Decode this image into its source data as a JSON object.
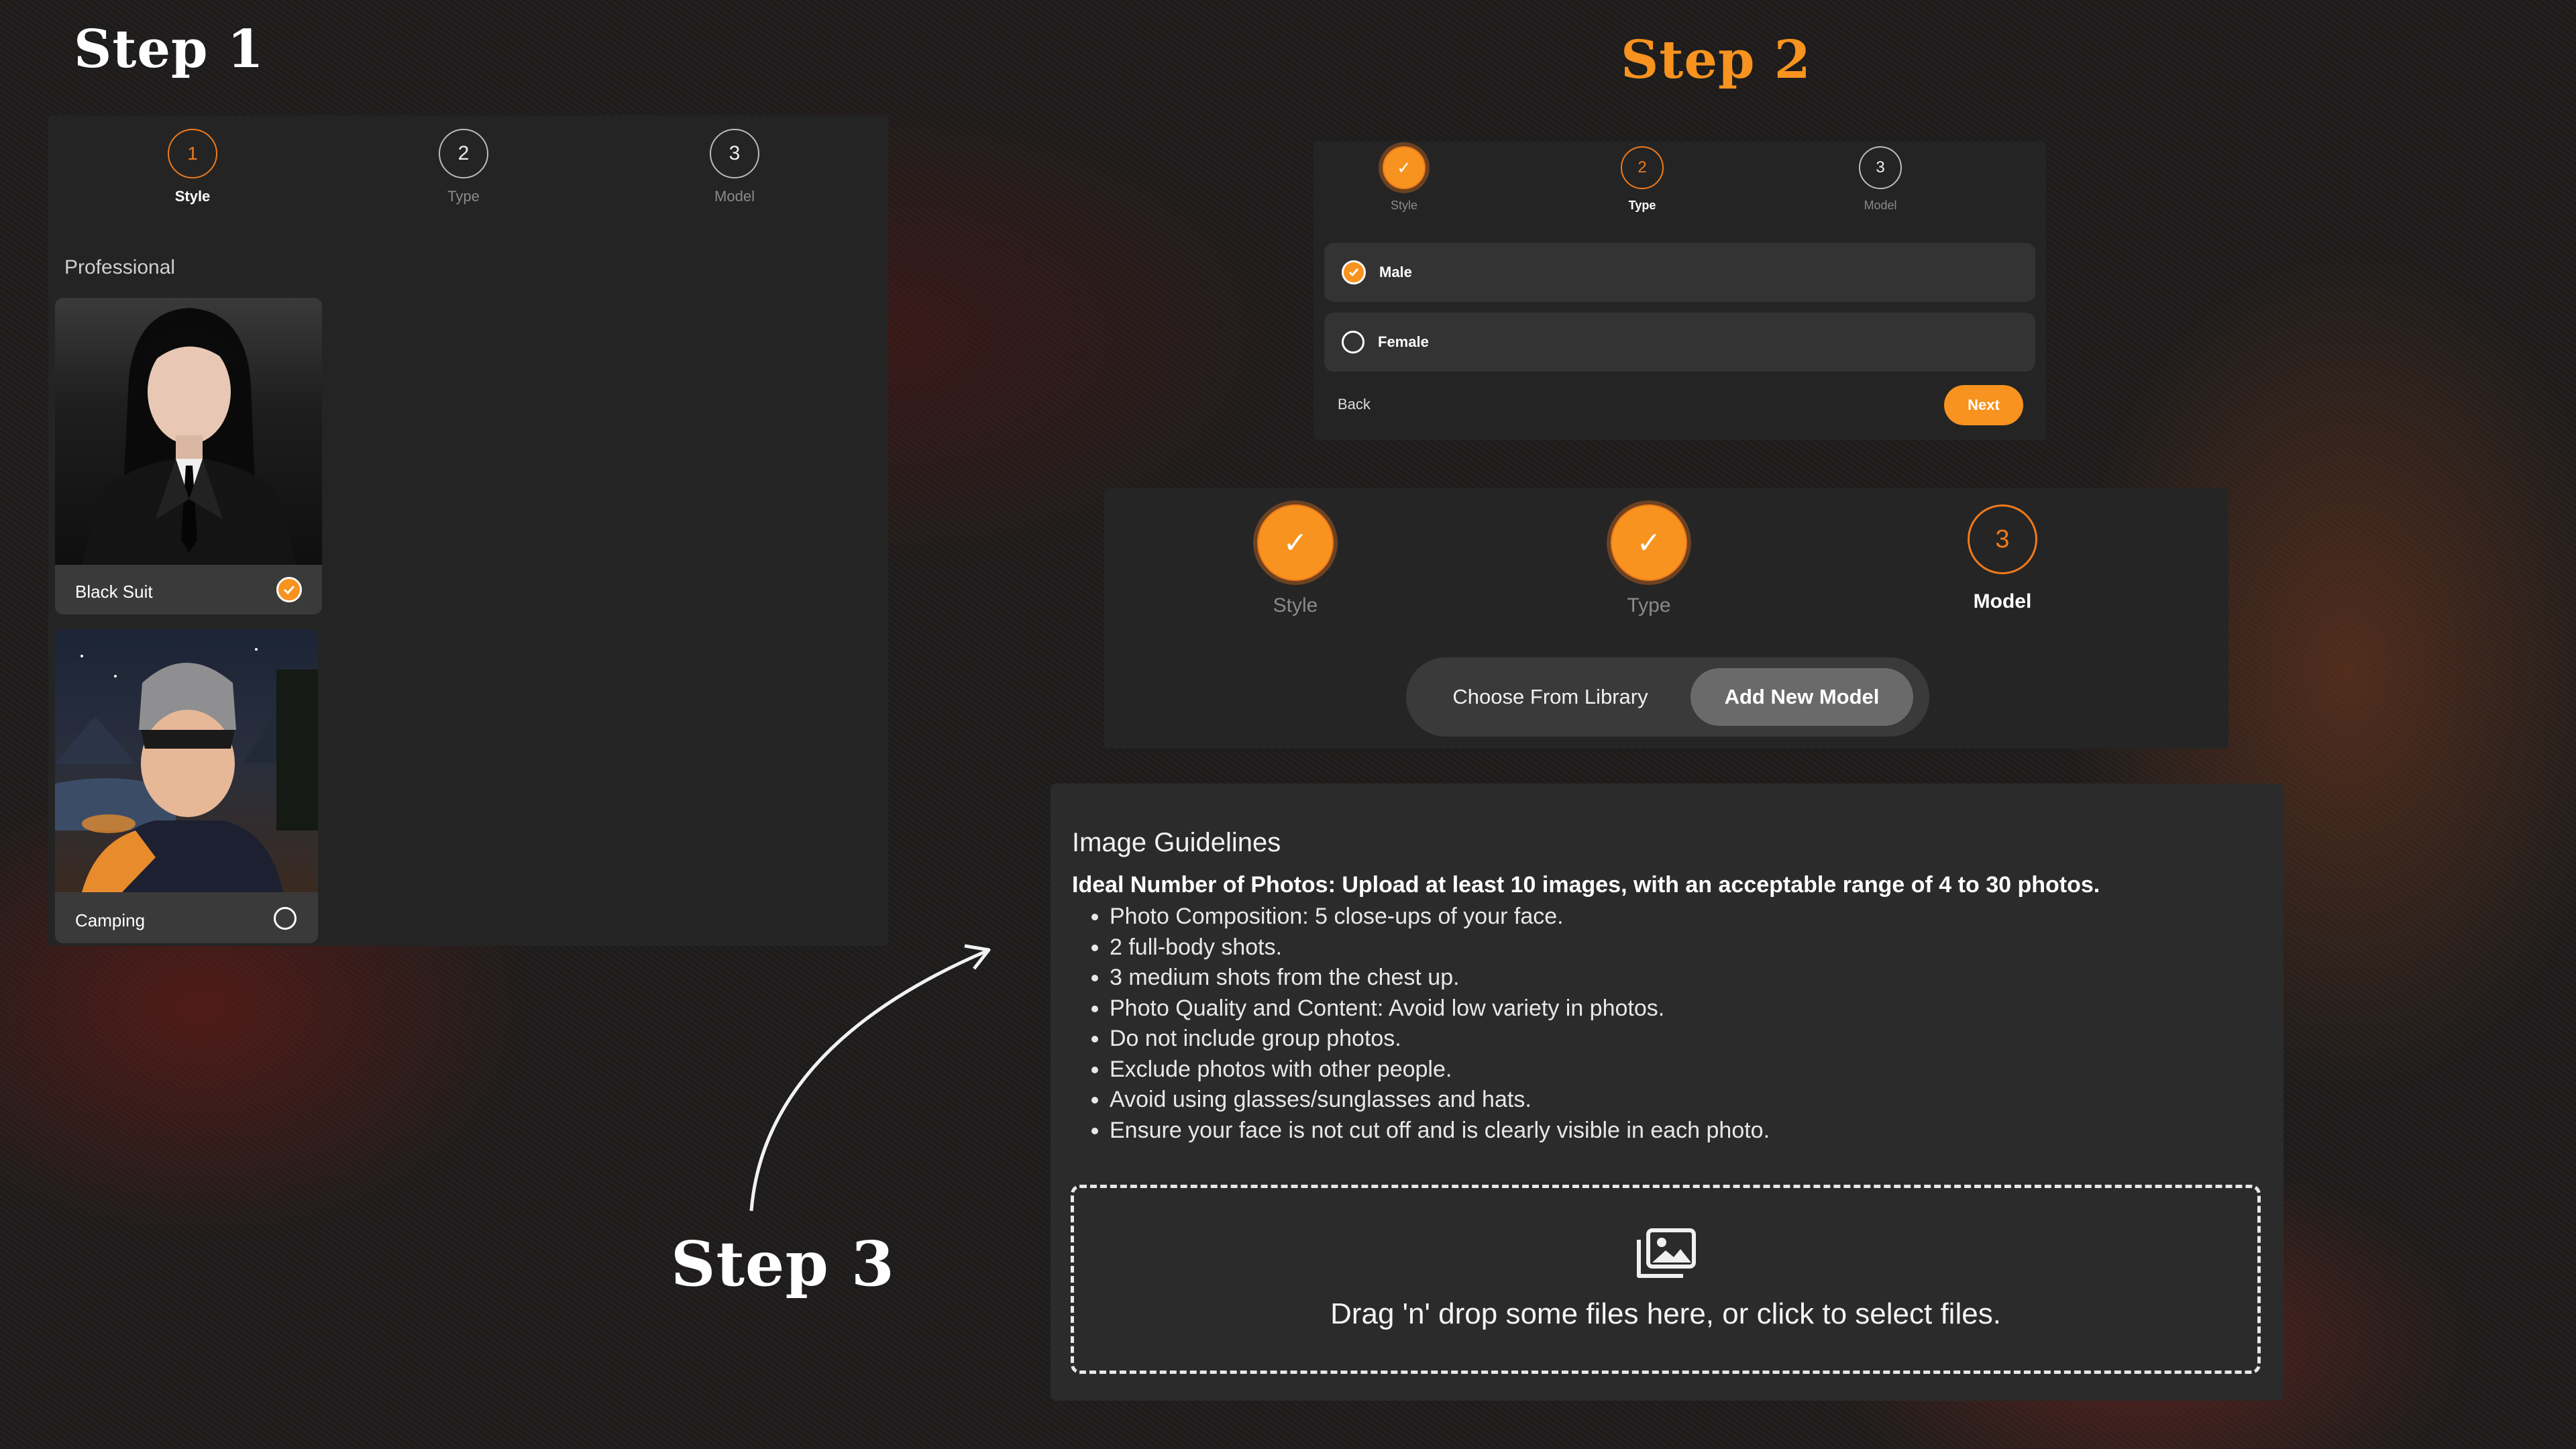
{
  "step1": {
    "title": "Step 1",
    "stepper": [
      {
        "num": "1",
        "label": "Style",
        "state": "active"
      },
      {
        "num": "2",
        "label": "Type",
        "state": "pending"
      },
      {
        "num": "3",
        "label": "Model",
        "state": "pending"
      }
    ],
    "section_label": "Professional",
    "cards": [
      {
        "label": "Black Suit",
        "selected": true
      },
      {
        "label": "Camping",
        "selected": false
      }
    ]
  },
  "step2": {
    "title": "Step 2",
    "stepper": [
      {
        "num": "✓",
        "label": "Style",
        "state": "done"
      },
      {
        "num": "2",
        "label": "Type",
        "state": "active"
      },
      {
        "num": "3",
        "label": "Model",
        "state": "pending"
      }
    ],
    "options": [
      {
        "label": "Male",
        "selected": true
      },
      {
        "label": "Female",
        "selected": false
      }
    ],
    "back_label": "Back",
    "next_label": "Next"
  },
  "step3": {
    "title": "Step 3",
    "stepper": [
      {
        "num": "✓",
        "label": "Style",
        "state": "done"
      },
      {
        "num": "✓",
        "label": "Type",
        "state": "done"
      },
      {
        "num": "3",
        "label": "Model",
        "state": "active"
      }
    ],
    "toggle": {
      "option_a": "Choose From Library",
      "option_b": "Add New Model",
      "selected": "Add New Model"
    },
    "guidelines": {
      "heading": "Image Guidelines",
      "intro": "Ideal Number of Photos: Upload at least 10 images, with an acceptable range of 4 to 30 photos.",
      "items": [
        "Photo Composition: 5 close-ups of your face.",
        "2 full-body shots.",
        "3 medium shots from the chest up.",
        "Photo Quality and Content: Avoid low variety in photos.",
        "Do not include group photos.",
        "Exclude photos with other people.",
        "Avoid using glasses/sunglasses and hats.",
        "Ensure your face is not cut off and is clearly visible in each photo."
      ]
    },
    "dropzone_text": "Drag 'n' drop some files here, or click to select files.",
    "dropzone_icon": "image-upload-icon"
  },
  "colors": {
    "accent": "#f7931e",
    "panel": "#242424",
    "step2_title": "#f7931e"
  }
}
